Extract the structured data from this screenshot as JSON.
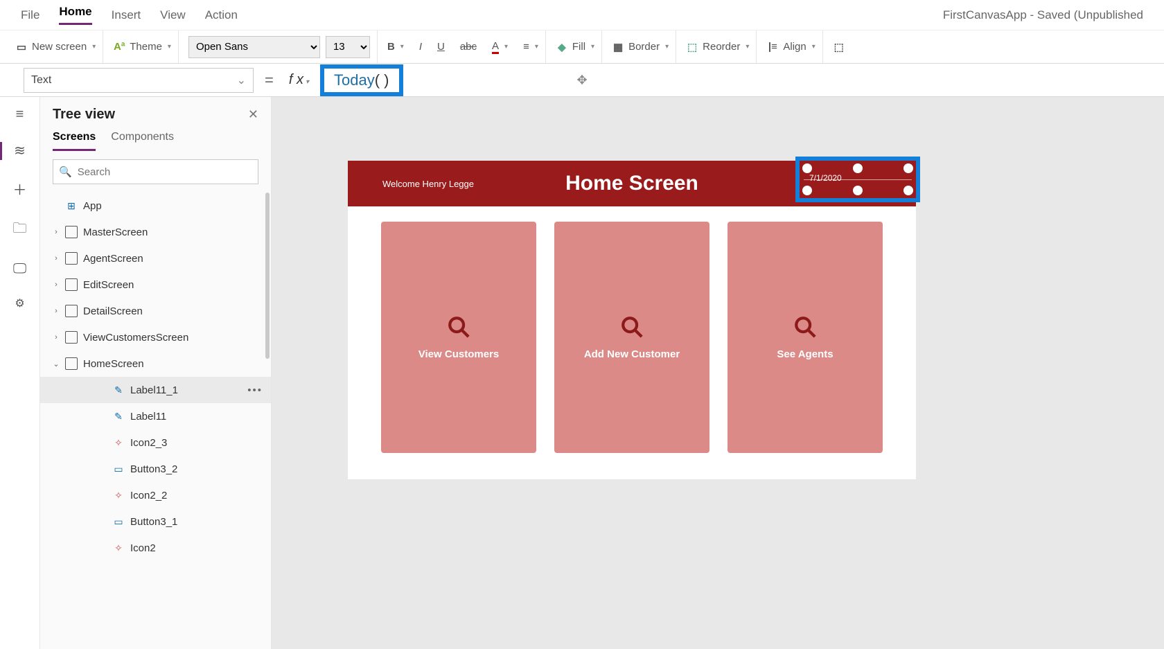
{
  "menu": {
    "file": "File",
    "home": "Home",
    "insert": "Insert",
    "view": "View",
    "action": "Action",
    "app_title": "FirstCanvasApp - Saved (Unpublished"
  },
  "ribbon": {
    "new_screen": "New screen",
    "theme": "Theme",
    "font_family": "Open Sans",
    "font_size": "13",
    "fill": "Fill",
    "border": "Border",
    "reorder": "Reorder",
    "align": "Align"
  },
  "formula_bar": {
    "property": "Text",
    "formula_fn": "Today",
    "formula_parens": "( )"
  },
  "tree": {
    "title": "Tree view",
    "tabs": {
      "screens": "Screens",
      "components": "Components"
    },
    "search_placeholder": "Search",
    "app_node": "App",
    "screens": [
      "MasterScreen",
      "AgentScreen",
      "EditScreen",
      "DetailScreen",
      "ViewCustomersScreen",
      "HomeScreen"
    ],
    "home_children": [
      "Label11_1",
      "Label11",
      "Icon2_3",
      "Button3_2",
      "Icon2_2",
      "Button3_1",
      "Icon2"
    ]
  },
  "canvas": {
    "welcome": "Welcome Henry Legge",
    "title": "Home Screen",
    "date": "7/1/2020",
    "tiles": [
      "View Customers",
      "Add New Customer",
      "See Agents"
    ]
  }
}
